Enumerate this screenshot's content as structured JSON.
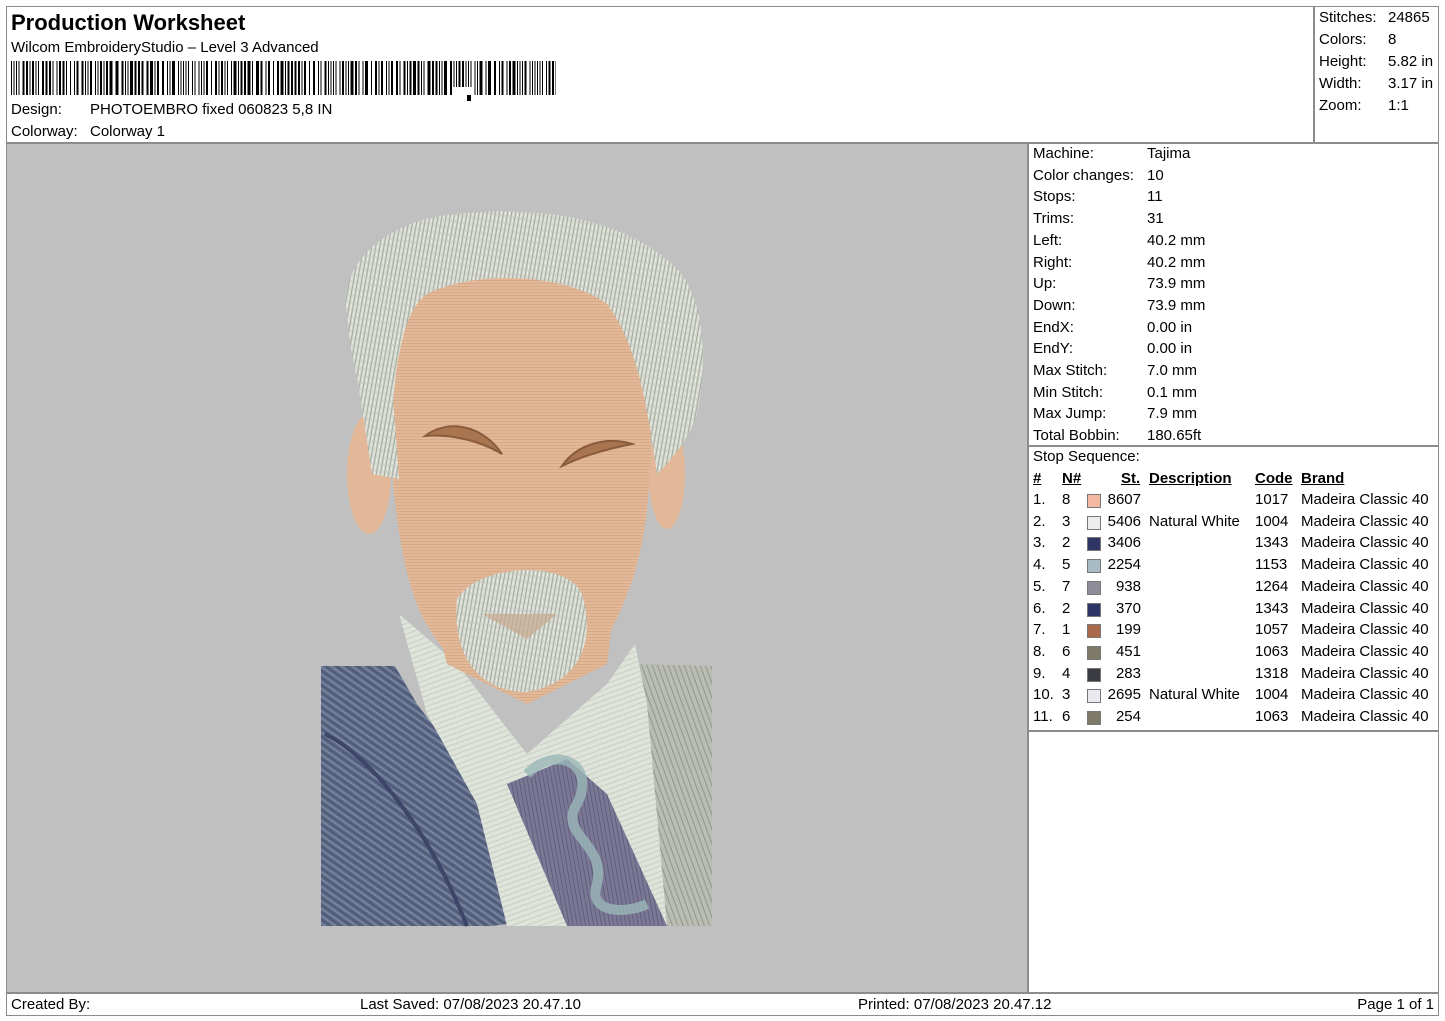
{
  "header": {
    "title": "Production Worksheet",
    "software": "Wilcom EmbroideryStudio – Level 3 Advanced",
    "design_label": "Design:",
    "design_value": "PHOTOEMBRO fixed 060823 5,8 IN",
    "colorway_label": "Colorway:",
    "colorway_value": "Colorway 1"
  },
  "stats": [
    {
      "label": "Stitches:",
      "value": "24865"
    },
    {
      "label": "Colors:",
      "value": "8"
    },
    {
      "label": "Height:",
      "value": "5.82 in"
    },
    {
      "label": "Width:",
      "value": "3.17 in"
    },
    {
      "label": "Zoom:",
      "value": "1:1"
    }
  ],
  "machine": [
    {
      "label": "Machine:",
      "value": "Tajima"
    },
    {
      "label": "Color changes:",
      "value": "10"
    },
    {
      "label": "Stops:",
      "value": "11"
    },
    {
      "label": "Trims:",
      "value": "31"
    },
    {
      "label": "Left:",
      "value": "40.2 mm"
    },
    {
      "label": "Right:",
      "value": "40.2 mm"
    },
    {
      "label": "Up:",
      "value": "73.9 mm"
    },
    {
      "label": "Down:",
      "value": "73.9 mm"
    },
    {
      "label": "EndX:",
      "value": "0.00 in"
    },
    {
      "label": "EndY:",
      "value": "0.00 in"
    },
    {
      "label": "Max Stitch:",
      "value": "7.0 mm"
    },
    {
      "label": "Min Stitch:",
      "value": "0.1 mm"
    },
    {
      "label": "Max Jump:",
      "value": "7.9 mm"
    },
    {
      "label": "Total Bobbin:",
      "value": "180.65ft"
    }
  ],
  "stop_sequence": {
    "title": "Stop Sequence:",
    "headers": {
      "num": "#",
      "n": "N#",
      "st": "St.",
      "description": "Description",
      "code": "Code",
      "brand": "Brand"
    },
    "rows": [
      {
        "num": "1.",
        "n": "8",
        "color": "#f2b8a2",
        "st": "8607",
        "description": "",
        "code": "1017",
        "brand": "Madeira Classic 40"
      },
      {
        "num": "2.",
        "n": "3",
        "color": "#ececec",
        "st": "5406",
        "description": "Natural White",
        "code": "1004",
        "brand": "Madeira Classic 40"
      },
      {
        "num": "3.",
        "n": "2",
        "color": "#2e3466",
        "st": "3406",
        "description": "",
        "code": "1343",
        "brand": "Madeira Classic 40"
      },
      {
        "num": "4.",
        "n": "5",
        "color": "#a8bcc4",
        "st": "2254",
        "description": "",
        "code": "1153",
        "brand": "Madeira Classic 40"
      },
      {
        "num": "5.",
        "n": "7",
        "color": "#8e8c98",
        "st": "938",
        "description": "",
        "code": "1264",
        "brand": "Madeira Classic 40"
      },
      {
        "num": "6.",
        "n": "2",
        "color": "#2e3466",
        "st": "370",
        "description": "",
        "code": "1343",
        "brand": "Madeira Classic 40"
      },
      {
        "num": "7.",
        "n": "1",
        "color": "#a9694a",
        "st": "199",
        "description": "",
        "code": "1057",
        "brand": "Madeira Classic 40"
      },
      {
        "num": "8.",
        "n": "6",
        "color": "#7d7a68",
        "st": "451",
        "description": "",
        "code": "1063",
        "brand": "Madeira Classic 40"
      },
      {
        "num": "9.",
        "n": "4",
        "color": "#3a3b40",
        "st": "283",
        "description": "",
        "code": "1318",
        "brand": "Madeira Classic 40"
      },
      {
        "num": "10.",
        "n": "3",
        "color": "#e8e8ee",
        "st": "2695",
        "description": "Natural White",
        "code": "1004",
        "brand": "Madeira Classic 40"
      },
      {
        "num": "11.",
        "n": "6",
        "color": "#7d7a68",
        "st": "254",
        "description": "",
        "code": "1063",
        "brand": "Madeira Classic 40"
      }
    ]
  },
  "footer": {
    "created_by": "Created By:",
    "last_saved": "Last Saved: 07/08/2023 20.47.10",
    "printed": "Printed: 07/08/2023 20.47.12",
    "page": "Page 1 of 1"
  },
  "colors": {
    "preview_bg": "#c0c0c0",
    "skin": "#e2b898",
    "hair": "#d6d9d0",
    "suit": "#5c6a88",
    "shirt": "#dde2da",
    "tie": "#7a7794"
  }
}
